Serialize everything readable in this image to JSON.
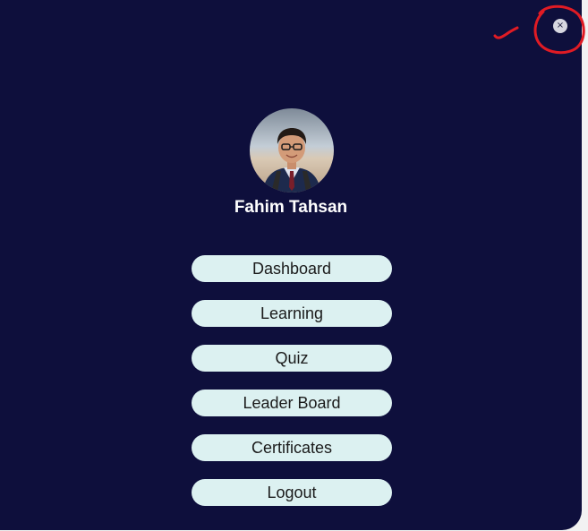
{
  "sidebar": {
    "close_label": "×",
    "user_name": "Fahim Tahsan",
    "menu": [
      {
        "label": "Dashboard"
      },
      {
        "label": "Learning"
      },
      {
        "label": "Quiz"
      },
      {
        "label": "Leader Board"
      },
      {
        "label": "Certificates"
      },
      {
        "label": "Logout"
      }
    ]
  },
  "colors": {
    "panel_background": "#0e0f3c",
    "menu_button": "#dcf1f1",
    "annotation": "#e01b24"
  }
}
